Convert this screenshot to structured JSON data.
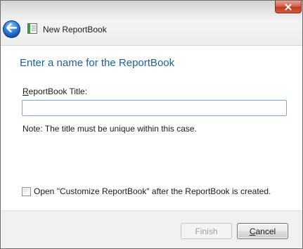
{
  "window": {
    "close_icon": "close-icon",
    "back_icon": "back-arrow-icon",
    "doc_icon": "reportbook-icon",
    "title": "New ReportBook"
  },
  "page": {
    "heading": "Enter a name for the ReportBook",
    "field_label_accel": "R",
    "field_label_rest": "eportBook Title:",
    "title_value": "",
    "note": "Note:  The title must be unique within this case.",
    "checkbox_label": "Open \"Customize ReportBook\" after the ReportBook is created.",
    "checkbox_checked": false
  },
  "footer": {
    "finish_label": "Finish",
    "finish_enabled": false,
    "cancel_accel": "C",
    "cancel_rest": "ancel"
  },
  "colors": {
    "heading": "#1f5e9c",
    "close_button": "#c23a1f",
    "back_button": "#3a86e0",
    "input_border": "#7fa5c9"
  }
}
